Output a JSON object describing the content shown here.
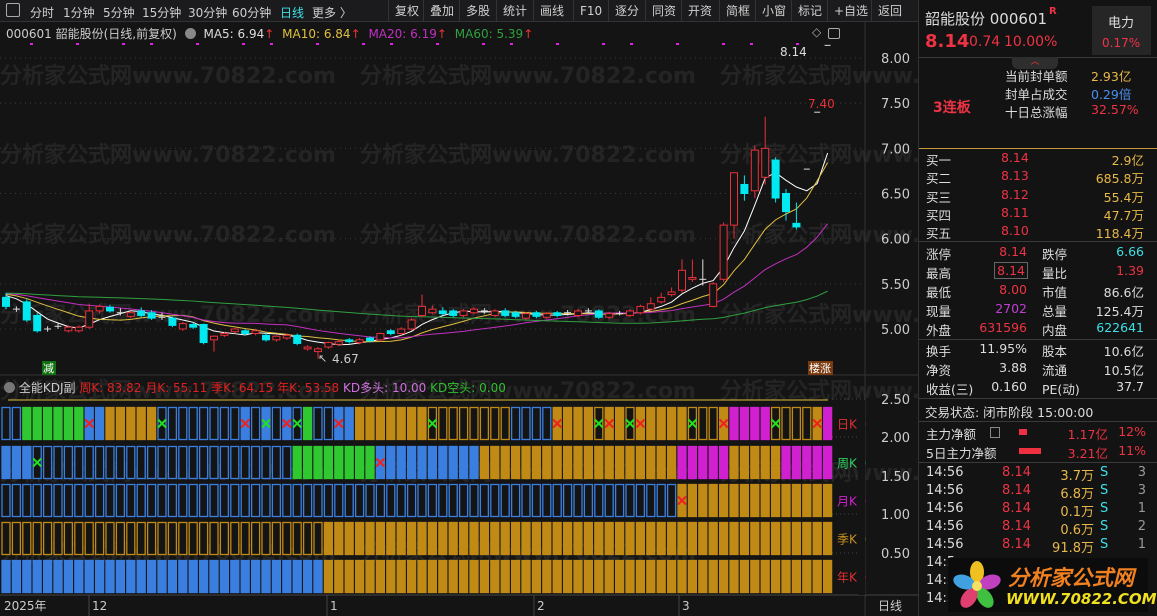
{
  "toolbar": {
    "periods": [
      "分时",
      "1分钟",
      "5分钟",
      "15分钟",
      "30分钟",
      "60分钟",
      "日线",
      "更多 〉"
    ],
    "active_period": "日线",
    "buttons": [
      "复权",
      "叠加",
      "多股",
      "统计",
      "画线",
      "F10",
      "逐分",
      "同资",
      "开资",
      "简框",
      "小窗",
      "标记",
      "+自选",
      "返回"
    ]
  },
  "legend": {
    "title": "000601 韶能股份(日线,前复权)",
    "ma5": "MA5: 6.94",
    "ma10": "MA10: 6.84",
    "ma20": "MA20: 6.19",
    "ma60": "MA60: 5.39",
    "up_arrow": "↑"
  },
  "indicator_legend": {
    "name": "全能KDJ副",
    "week_k": "周K: 83.82",
    "month_k": "月K: 55.11",
    "season_k": "季K: 64.15",
    "year_k": "年K: 53.58",
    "kd_long": "KD多头: 10.00",
    "kd_short": "KD空头: 0.00"
  },
  "watermark": "分析家公式网www.70822.com",
  "chart_data": {
    "type": "candlestick",
    "price_axis": [
      "8.00",
      "7.50",
      "7.00",
      "6.50",
      "6.00",
      "5.50",
      "5.00"
    ],
    "ylim": [
      4.6,
      8.2
    ],
    "annotations": {
      "high_label": "8.14",
      "mid_label": "7.40",
      "low_label": "4.67",
      "sell_tag": "减",
      "rise_tag": "楼涨"
    },
    "date_axis": [
      "2025年",
      "12",
      "1",
      "2",
      "3"
    ],
    "period_label": "日线",
    "ohlc": [
      [
        5.35,
        5.4,
        5.22,
        5.25
      ],
      [
        5.22,
        5.25,
        5.19,
        5.22
      ],
      [
        5.3,
        5.33,
        5.08,
        5.1
      ],
      [
        5.15,
        5.18,
        4.96,
        4.98
      ],
      [
        5.0,
        5.03,
        4.97,
        5.0
      ],
      [
        5.03,
        5.06,
        5.0,
        5.03
      ],
      [
        4.98,
        5.04,
        4.96,
        5.02
      ],
      [
        4.98,
        5.04,
        4.96,
        5.02
      ],
      [
        5.02,
        5.28,
        5.0,
        5.2
      ],
      [
        5.2,
        5.27,
        5.17,
        5.25
      ],
      [
        5.24,
        5.27,
        5.18,
        5.2
      ],
      [
        5.18,
        5.23,
        5.15,
        5.18
      ],
      [
        5.14,
        5.2,
        5.12,
        5.18
      ],
      [
        5.2,
        5.24,
        5.13,
        5.15
      ],
      [
        5.18,
        5.21,
        5.1,
        5.12
      ],
      [
        5.13,
        5.18,
        5.1,
        5.13
      ],
      [
        5.12,
        5.14,
        5.02,
        5.04
      ],
      [
        5.0,
        5.08,
        4.98,
        5.06
      ],
      [
        5.05,
        5.07,
        5.0,
        5.02
      ],
      [
        5.05,
        5.06,
        4.83,
        4.85
      ],
      [
        4.88,
        4.93,
        4.75,
        4.92
      ],
      [
        4.93,
        4.97,
        4.91,
        4.95
      ],
      [
        4.97,
        5.01,
        4.95,
        5.0
      ],
      [
        4.98,
        5.0,
        4.93,
        4.95
      ],
      [
        4.95,
        5.0,
        4.93,
        4.98
      ],
      [
        4.93,
        4.96,
        4.86,
        4.88
      ],
      [
        4.88,
        4.93,
        4.86,
        4.92
      ],
      [
        4.9,
        4.95,
        4.88,
        4.93
      ],
      [
        4.93,
        4.95,
        4.82,
        4.84
      ],
      [
        4.78,
        4.82,
        4.76,
        4.8
      ],
      [
        4.75,
        4.8,
        4.67,
        4.78
      ],
      [
        4.8,
        4.86,
        4.78,
        4.85
      ],
      [
        4.83,
        4.88,
        4.81,
        4.86
      ],
      [
        4.88,
        4.9,
        4.84,
        4.86
      ],
      [
        4.85,
        4.9,
        4.83,
        4.88
      ],
      [
        4.9,
        4.92,
        4.85,
        4.87
      ],
      [
        4.88,
        4.96,
        4.86,
        4.95
      ],
      [
        4.98,
        5.0,
        4.93,
        4.95
      ],
      [
        4.95,
        5.02,
        4.93,
        5.0
      ],
      [
        5.0,
        5.12,
        4.98,
        5.1
      ],
      [
        5.15,
        5.38,
        5.13,
        5.25
      ],
      [
        5.18,
        5.26,
        5.16,
        5.22
      ],
      [
        5.2,
        5.24,
        5.15,
        5.17
      ],
      [
        5.2,
        5.22,
        5.13,
        5.15
      ],
      [
        5.15,
        5.22,
        5.13,
        5.2
      ],
      [
        5.18,
        5.24,
        5.16,
        5.22
      ],
      [
        5.2,
        5.23,
        5.17,
        5.2
      ],
      [
        5.15,
        5.22,
        5.13,
        5.2
      ],
      [
        5.2,
        5.23,
        5.13,
        5.15
      ],
      [
        5.18,
        5.2,
        5.12,
        5.14
      ],
      [
        5.12,
        5.19,
        5.1,
        5.17
      ],
      [
        5.18,
        5.2,
        5.12,
        5.14
      ],
      [
        5.13,
        5.19,
        5.11,
        5.17
      ],
      [
        5.18,
        5.2,
        5.13,
        5.15
      ],
      [
        5.18,
        5.21,
        5.15,
        5.18
      ],
      [
        5.15,
        5.22,
        5.13,
        5.2
      ],
      [
        5.2,
        5.23,
        5.17,
        5.2
      ],
      [
        5.2,
        5.22,
        5.11,
        5.13
      ],
      [
        5.13,
        5.19,
        5.11,
        5.17
      ],
      [
        5.17,
        5.2,
        5.15,
        5.17
      ],
      [
        5.15,
        5.22,
        5.13,
        5.2
      ],
      [
        5.18,
        5.27,
        5.16,
        5.25
      ],
      [
        5.22,
        5.35,
        5.2,
        5.28
      ],
      [
        5.3,
        5.4,
        5.28,
        5.35
      ],
      [
        5.38,
        5.46,
        5.36,
        5.41
      ],
      [
        5.43,
        5.77,
        5.4,
        5.65
      ],
      [
        5.55,
        5.77,
        5.52,
        5.57
      ],
      [
        5.55,
        5.77,
        5.48,
        5.55
      ],
      [
        5.25,
        5.52,
        5.24,
        5.5
      ],
      [
        5.55,
        6.18,
        5.52,
        6.15
      ],
      [
        6.15,
        6.73,
        6.0,
        6.73
      ],
      [
        6.6,
        6.7,
        6.42,
        6.5
      ],
      [
        6.53,
        7.03,
        6.45,
        6.98
      ],
      [
        6.68,
        7.35,
        6.6,
        7.0
      ],
      [
        6.87,
        6.9,
        6.4,
        6.45
      ],
      [
        6.5,
        6.55,
        6.2,
        6.3
      ],
      [
        6.17,
        6.4,
        6.1,
        6.13
      ],
      [
        6.77,
        6.77,
        6.77,
        6.77
      ],
      [
        7.4,
        7.4,
        7.4,
        7.4
      ],
      [
        8.14,
        8.14,
        8.14,
        8.14
      ]
    ],
    "kdj": {
      "axis": [
        "2.50",
        "2.00",
        "1.50",
        "1.00",
        "0.50"
      ],
      "rows": [
        {
          "label": "日KD",
          "color": "#e03030",
          "states": "bbggggggBByyyyybbbbbbbbBbBbBbgbbBByyyyyyyoooooooobbbbyyyyoyyoyyyyyoooymmmmooooym",
          "red_marks": [
            8,
            23,
            27,
            32,
            53,
            58,
            61,
            69,
            78
          ],
          "green_marks": [
            15,
            25,
            28,
            41,
            57,
            60,
            66,
            74
          ]
        },
        {
          "label": "周KD",
          "color": "#30d060",
          "states": "BBBbbbbbbbbbbbbbbbbbbbbbbbbbggggggggBBBBBBBBBByyyyyyyyyyyyyyyyyyymmmmmyyyyymmmmm",
          "red_marks": [
            36
          ],
          "green_marks": [
            3
          ]
        },
        {
          "label": "月KD",
          "color": "#d020d0",
          "states": "bbbbbbbbbbbbbbbbbbbbbbbbbbbbbbbbbbbbbbbbbbbbbbbbbbbbbbbbbbbbbbbbbyyyyyyyyyyyyyyy",
          "red_marks": [
            65
          ],
          "green_marks": []
        },
        {
          "label": "季KD",
          "color": "#c89020",
          "states": "oooooooooooooooooooooooooooooooyyyyyyyyyyyyyyyyyyyyyyyyyyyyyyyyyyyyyyyyyyyyyyyyy",
          "red_marks": [],
          "green_marks": []
        },
        {
          "label": "年KD",
          "color": "#e03030",
          "states": "BBBBBBBBBBBBBBBBBBBBBBBBBBBBBBByyyyyyyyyyyyyyyyyyyyyyyyyyyyyyyyyyyyyyyyyyyyyyyyy",
          "red_marks": [],
          "green_marks": []
        }
      ]
    }
  },
  "quote": {
    "name_code": "韶能股份 000601",
    "r_badge": "R",
    "price": "8.14",
    "change": "0.74",
    "change_pct": "10.00%",
    "sector": "电力",
    "sector_pct": "0.17%",
    "streak": "3连板",
    "seal": [
      {
        "label": "当前封单额",
        "value": "2.93亿",
        "color": "gold"
      },
      {
        "label": "封单占成交",
        "value": "0.29倍",
        "color": "blue"
      },
      {
        "label": "十日总涨幅",
        "value": "32.57%",
        "color": "red"
      }
    ],
    "bids": [
      {
        "label": "买一",
        "price": "8.14",
        "vol": "2.9亿"
      },
      {
        "label": "买二",
        "price": "8.13",
        "vol": "685.8万"
      },
      {
        "label": "买三",
        "price": "8.12",
        "vol": "55.4万"
      },
      {
        "label": "买四",
        "price": "8.11",
        "vol": "47.7万"
      },
      {
        "label": "买五",
        "price": "8.10",
        "vol": "118.4万"
      }
    ],
    "stats1": [
      {
        "l1": "涨停",
        "v1": "8.14",
        "c1": "red",
        "l2": "跌停",
        "v2": "6.66",
        "c2": "cyan"
      },
      {
        "l1": "最高",
        "v1": "8.14",
        "c1": "red",
        "l2": "量比",
        "v2": "1.39",
        "c2": "red"
      },
      {
        "l1": "最低",
        "v1": "8.00",
        "c1": "red",
        "l2": "市值",
        "v2": "86.6亿",
        "c2": "white"
      },
      {
        "l1": "现量",
        "v1": "2702",
        "c1": "purple",
        "l2": "总量",
        "v2": "125.4万",
        "c2": "white"
      },
      {
        "l1": "外盘",
        "v1": "631596",
        "c1": "red",
        "l2": "内盘",
        "v2": "622641",
        "c2": "cyan"
      }
    ],
    "stats2": [
      {
        "l1": "换手",
        "v1": "11.95%",
        "c1": "white",
        "l2": "股本",
        "v2": "10.6亿",
        "c2": "white"
      },
      {
        "l1": "净资",
        "v1": "3.88",
        "c1": "white",
        "l2": "流通",
        "v2": "10.5亿",
        "c2": "white"
      },
      {
        "l1": "收益(三)",
        "v1": "0.160",
        "c1": "white",
        "l2": "PE(动)",
        "v2": "37.7",
        "c2": "white"
      }
    ],
    "status": "交易状态: 闭市阶段 15:00:00",
    "flows": [
      {
        "label": "主力净额",
        "value": "1.17亿",
        "pct": "12%",
        "bar": 0.37
      },
      {
        "label": "5日主力净额",
        "value": "3.21亿",
        "pct": "11%",
        "bar": 1
      }
    ],
    "trades": [
      {
        "time": "14:56",
        "price": "8.14",
        "vol": "3.7万",
        "side": "S",
        "n": "3"
      },
      {
        "time": "14:56",
        "price": "8.14",
        "vol": "6.8万",
        "side": "S",
        "n": "3"
      },
      {
        "time": "14:56",
        "price": "8.14",
        "vol": "0.1万",
        "side": "S",
        "n": "1"
      },
      {
        "time": "14:56",
        "price": "8.14",
        "vol": "0.6万",
        "side": "S",
        "n": "2"
      },
      {
        "time": "14:56",
        "price": "8.14",
        "vol": "91.8万",
        "side": "S",
        "n": "1"
      },
      {
        "time": "14:5",
        "price": "",
        "vol": "",
        "side": "",
        "n": ""
      },
      {
        "time": "14:5",
        "price": "",
        "vol": "",
        "side": "",
        "n": ""
      },
      {
        "time": "14:5",
        "price": "",
        "vol": "",
        "side": "",
        "n": ""
      }
    ]
  },
  "logo": {
    "name": "分析家公式网",
    "url": "WWW.70822.COM"
  }
}
